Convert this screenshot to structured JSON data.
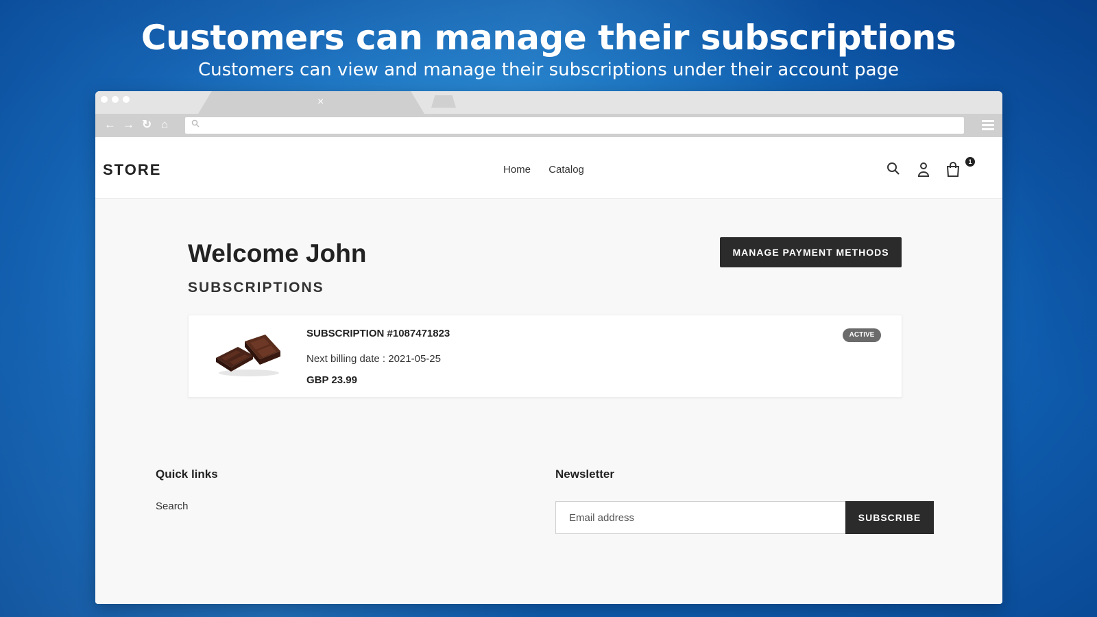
{
  "banner": {
    "headline": "Customers can manage their subscriptions",
    "subheadline": "Customers can view and manage their subscriptions under their account page"
  },
  "browser": {
    "tab_close": "×",
    "icons": [
      "back-icon",
      "forward-icon",
      "reload-icon",
      "home-icon",
      "search-icon",
      "menu-icon"
    ]
  },
  "store": {
    "logo": "STORE",
    "nav": [
      "Home",
      "Catalog"
    ],
    "cart_count": "1"
  },
  "account": {
    "welcome": "Welcome John",
    "manage_payment_label": "MANAGE PAYMENT METHODS",
    "subscriptions_title": "SUBSCRIPTIONS"
  },
  "subscription": {
    "id_label": "SUBSCRIPTION #1087471823",
    "next_billing": "Next billing date : 2021-05-25",
    "price": "GBP 23.99",
    "status": "ACTIVE"
  },
  "footer": {
    "quick_links_title": "Quick links",
    "quick_links": [
      "Search"
    ],
    "newsletter_title": "Newsletter",
    "email_placeholder": "Email address",
    "subscribe_label": "SUBSCRIBE"
  },
  "colors": {
    "dark_button": "#2b2b2b",
    "badge": "#6b6b6b",
    "page_bg": "#f8f8f8"
  }
}
